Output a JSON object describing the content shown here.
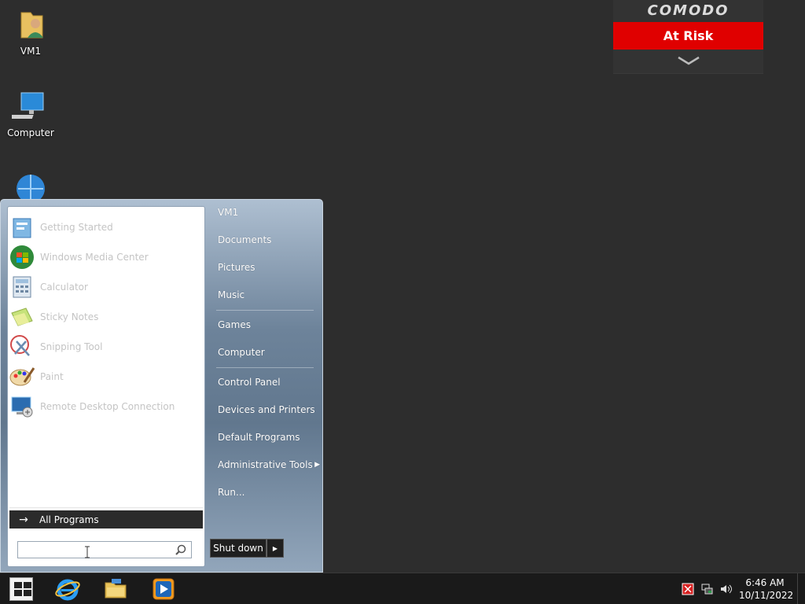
{
  "desktop": {
    "icons": [
      {
        "label": "VM1",
        "icon": "user-folder-icon"
      },
      {
        "label": "Computer",
        "icon": "computer-icon"
      },
      {
        "label": "",
        "icon": "network-icon"
      }
    ]
  },
  "comodo": {
    "brand": "COMODO",
    "status": "At Risk",
    "status_color": "#e00000",
    "expand_icon": "chevron-down-icon"
  },
  "start_menu": {
    "programs": [
      {
        "label": "Getting Started",
        "icon": "getting-started-icon"
      },
      {
        "label": "Windows Media Center",
        "icon": "media-center-icon"
      },
      {
        "label": "Calculator",
        "icon": "calculator-icon"
      },
      {
        "label": "Sticky Notes",
        "icon": "sticky-notes-icon"
      },
      {
        "label": "Snipping Tool",
        "icon": "snipping-tool-icon"
      },
      {
        "label": "Paint",
        "icon": "paint-icon"
      },
      {
        "label": "Remote Desktop Connection",
        "icon": "remote-desktop-icon"
      }
    ],
    "all_programs": "All Programs",
    "search_placeholder": "",
    "right_items": [
      {
        "label": "VM1"
      },
      {
        "label": "Documents"
      },
      {
        "label": "Pictures"
      },
      {
        "label": "Music"
      },
      {
        "label": "Games"
      },
      {
        "label": "Computer"
      },
      {
        "label": "Control Panel"
      },
      {
        "label": "Devices and Printers"
      },
      {
        "label": "Default Programs"
      },
      {
        "label": "Administrative Tools"
      },
      {
        "label": "Run..."
      }
    ],
    "shutdown_label": "Shut down"
  },
  "taskbar": {
    "apps": [
      "internet-explorer-icon",
      "file-explorer-icon",
      "media-player-icon"
    ],
    "tray": [
      "comodo-tray-icon",
      "network-tray-icon",
      "volume-icon"
    ],
    "time": "6:46 AM",
    "date": "10/11/2022"
  }
}
